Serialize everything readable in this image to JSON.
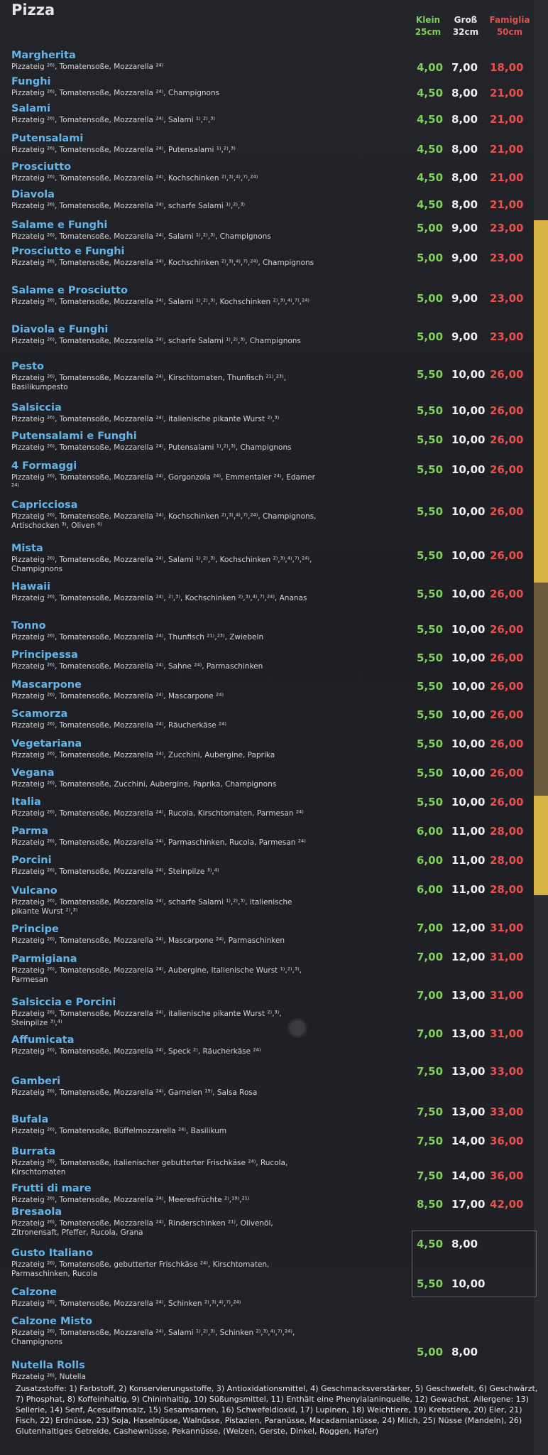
{
  "title": "Pizza",
  "headers": {
    "small": [
      "Klein",
      "25cm"
    ],
    "medium": [
      "Groß",
      "32cm"
    ],
    "large": [
      "Famiglia",
      "50cm"
    ]
  },
  "items": [
    {
      "name": "Margherita",
      "desc": "Pizzateig ²⁶⁾, Tomatensoße, Mozzarella ²⁴⁾",
      "small": "4,00",
      "medium": "7,00",
      "large": "18,00"
    },
    {
      "name": "Funghi",
      "desc": "Pizzateig ²⁶⁾, Tomatensoße, Mozzarella ²⁴⁾, Champignons",
      "small": "4,50",
      "medium": "8,00",
      "large": "21,00"
    },
    {
      "name": "Salami",
      "desc": "Pizzateig ²⁶⁾, Tomatensoße, Mozzarella ²⁴⁾, Salami ¹⁾,²⁾,³⁾",
      "small": "4,50",
      "medium": "8,00",
      "large": "21,00"
    },
    {
      "name": "Putensalami",
      "desc": "Pizzateig ²⁶⁾, Tomatensoße, Mozzarella ²⁴⁾, Putensalami ¹⁾,²⁾,³⁾",
      "small": "4,50",
      "medium": "8,00",
      "large": "21,00"
    },
    {
      "name": "Prosciutto",
      "desc": "Pizzateig ²⁶⁾, Tomatensoße, Mozzarella ²⁴⁾, Kochschinken ²⁾,³⁾,⁴⁾,⁷⁾,²⁴⁾",
      "small": "4,50",
      "medium": "8,00",
      "large": "21,00"
    },
    {
      "name": "Diavola",
      "desc": "Pizzateig ²⁶⁾, Tomatensoße, Mozzarella ²⁴⁾, scharfe Salami ¹⁾,²⁾,³⁾",
      "small": "4,50",
      "medium": "8,00",
      "large": "21,00"
    },
    {
      "name": "Salame e Funghi",
      "desc": "Pizzateig ²⁶⁾, Tomatensoße, Mozzarella ²⁴⁾, Salami ¹⁾,²⁾,³⁾, Champignons",
      "small": "5,00",
      "medium": "9,00",
      "large": "23,00"
    },
    {
      "name": "Prosciutto e Funghi",
      "desc": "Pizzateig ²⁶⁾, Tomatensoße, Mozzarella ²⁴⁾, Kochschinken ²⁾,³⁾,⁴⁾,⁷⁾,²⁴⁾, Champignons",
      "small": "5,00",
      "medium": "9,00",
      "large": "23,00"
    },
    {
      "name": "Salame e Prosciutto",
      "desc": "Pizzateig ²⁶⁾, Tomatensoße, Mozzarella ²⁴⁾, Salami ¹⁾,²⁾,³⁾, Kochschinken ²⁾,³⁾,⁴⁾,⁷⁾,²⁴⁾",
      "small": "5,00",
      "medium": "9,00",
      "large": "23,00"
    },
    {
      "name": "Diavola e Funghi",
      "desc": "Pizzateig ²⁶⁾, Tomatensoße, Mozzarella ²⁴⁾, scharfe Salami ¹⁾,²⁾,³⁾, Champignons",
      "small": "5,00",
      "medium": "9,00",
      "large": "23,00"
    },
    {
      "name": "Pesto",
      "desc": "Pizzateig ²⁶⁾, Tomatensoße, Mozzarella ²⁴⁾, Kirschtomaten, Thunfisch ²¹⁾,²³⁾, Basilikumpesto",
      "small": "5,50",
      "medium": "10,00",
      "large": "26,00"
    },
    {
      "name": "Salsiccia",
      "desc": "Pizzateig ²⁶⁾, Tomatensoße, Mozzarella ²⁴⁾, italienische pikante Wurst ²⁾,³⁾",
      "small": "5,50",
      "medium": "10,00",
      "large": "26,00"
    },
    {
      "name": "Putensalami e Funghi",
      "desc": "Pizzateig ²⁶⁾, Tomatensoße, Mozzarella ²⁴⁾, Putensalami ¹⁾,²⁾,³⁾, Champignons",
      "small": "5,50",
      "medium": "10,00",
      "large": "26,00"
    },
    {
      "name": "4 Formaggi",
      "desc": "Pizzateig ²⁶⁾, Tomatensoße, Mozzarella ²⁴⁾, Gorgonzola ²⁴⁾, Emmentaler ²⁴⁾, Edamer ²⁴⁾",
      "small": "5,50",
      "medium": "10,00",
      "large": "26,00"
    },
    {
      "name": "Capricciosa",
      "desc": "Pizzateig ²⁶⁾, Tomatensoße, Mozzarella ²⁴⁾, Kochschinken ²⁾,³⁾,⁴⁾,⁷⁾,²⁴⁾, Champignons, Artischocken ³⁾, Oliven ⁶⁾",
      "small": "5,50",
      "medium": "10,00",
      "large": "26,00"
    },
    {
      "name": "Mista",
      "desc": "Pizzateig ²⁶⁾, Tomatensoße, Mozzarella ²⁴⁾, Salami ¹⁾,²⁾,³⁾, Kochschinken ²⁾,³⁾,⁴⁾,⁷⁾,²⁴⁾, Champignons",
      "small": "5,50",
      "medium": "10,00",
      "large": "26,00"
    },
    {
      "name": "Hawaii",
      "desc": "Pizzateig ²⁶⁾, Tomatensoße, Mozzarella ²⁴⁾, ²⁾,³⁾, Kochschinken ²⁾,³⁾,⁴⁾,⁷⁾,²⁴⁾, Ananas",
      "small": "5,50",
      "medium": "10,00",
      "large": "26,00"
    },
    {
      "name": "Tonno",
      "desc": "Pizzateig ²⁶⁾, Tomatensoße, Mozzarella ²⁴⁾, Thunfisch ²¹⁾,²³⁾, Zwiebeln",
      "small": "5,50",
      "medium": "10,00",
      "large": "26,00"
    },
    {
      "name": "Principessa",
      "desc": "Pizzateig ²⁶⁾, Tomatensoße, Mozzarella ²⁴⁾, Sahne ²⁴⁾, Parmaschinken",
      "small": "5,50",
      "medium": "10,00",
      "large": "26,00"
    },
    {
      "name": "Mascarpone",
      "desc": "Pizzateig ²⁶⁾, Tomatensoße, Mozzarella ²⁴⁾, Mascarpone ²⁴⁾",
      "small": "5,50",
      "medium": "10,00",
      "large": "26,00"
    },
    {
      "name": "Scamorza",
      "desc": "Pizzateig ²⁶⁾, Tomatensoße, Mozzarella ²⁴⁾, Räucherkäse ²⁴⁾",
      "small": "5,50",
      "medium": "10,00",
      "large": "26,00"
    },
    {
      "name": "Vegetariana",
      "desc": "Pizzateig ²⁶⁾, Tomatensoße, Mozzarella ²⁴⁾, Zucchini, Aubergine, Paprika",
      "small": "5,50",
      "medium": "10,00",
      "large": "26,00"
    },
    {
      "name": "Vegana",
      "desc": "Pizzateig ²⁶⁾, Tomatensoße, Zucchini, Aubergine, Paprika, Champignons",
      "small": "5,50",
      "medium": "10,00",
      "large": "26,00"
    },
    {
      "name": "Italia",
      "desc": "Pizzateig ²⁶⁾, Tomatensoße, Mozzarella ²⁴⁾, Rucola, Kirschtomaten, Parmesan ²⁴⁾",
      "small": "5,50",
      "medium": "10,00",
      "large": "26,00"
    },
    {
      "name": "Parma",
      "desc": "Pizzateig ²⁶⁾, Tomatensoße, Mozzarella ²⁴⁾, Parmaschinken, Rucola, Parmesan ²⁴⁾",
      "small": "6,00",
      "medium": "11,00",
      "large": "28,00"
    },
    {
      "name": "Porcini",
      "desc": "Pizzateig ²⁶⁾, Tomatensoße, Mozzarella ²⁴⁾, Steinpilze ³⁾,⁴⁾",
      "small": "6,00",
      "medium": "11,00",
      "large": "28,00"
    },
    {
      "name": "Vulcano",
      "desc": "Pizzateig ²⁶⁾, Tomatensoße, Mozzarella ²⁴⁾, scharfe Salami ¹⁾,²⁾,³⁾, italienische pikante Wurst ²⁾,³⁾",
      "small": "6,00",
      "medium": "11,00",
      "large": "28,00"
    },
    {
      "name": "Principe",
      "desc": "Pizzateig ²⁶⁾, Tomatensoße, Mozzarella ²⁴⁾, Mascarpone ²⁴⁾, Parmaschinken",
      "small": "7,00",
      "medium": "12,00",
      "large": "31,00"
    },
    {
      "name": "Parmigiana",
      "desc": "Pizzateig ²⁶⁾, Tomatensoße, Mozzarella ²⁴⁾, Aubergine, Italienische Wurst ¹⁾,²⁾,³⁾, Parmesan",
      "small": "7,00",
      "medium": "12,00",
      "large": "31,00"
    },
    {
      "name": "Salsiccia e Porcini",
      "desc": "Pizzateig ²⁶⁾, Tomatensoße, Mozzarella ²⁴⁾, italienische pikante Wurst ²⁾,³⁾, Steinpilze ³⁾,⁴⁾",
      "small": "7,00",
      "medium": "13,00",
      "large": "31,00"
    },
    {
      "name": "Affumicata",
      "desc": "Pizzateig ²⁶⁾, Tomatensoße, Mozzarella ²⁴⁾, Speck ²⁾, Räucherkäse ²⁴⁾",
      "small": "7,00",
      "medium": "13,00",
      "large": "31,00"
    },
    {
      "name": "Gamberi",
      "desc": "Pizzateig ²⁶⁾, Tomatensoße, Mozzarella ²⁴⁾, Garnelen ¹⁹⁾, Salsa Rosa",
      "small": "7,50",
      "medium": "13,00",
      "large": "33,00"
    },
    {
      "name": "Bufala",
      "desc": "Pizzateig ²⁶⁾, Tomatensoße, Büffelmozzarella ²⁴⁾, Basilikum",
      "small": "7,50",
      "medium": "13,00",
      "large": "33,00"
    },
    {
      "name": "Burrata",
      "desc": "Pizzateig ²⁶⁾, Tomatensoße, italienischer gebutterter Frischkäse ²⁴⁾, Rucola, Kirschtomaten",
      "small": "7,50",
      "medium": "14,00",
      "large": "36,00"
    },
    {
      "name": "Frutti di mare",
      "desc": "Pizzateig ²⁶⁾, Tomatensoße, Mozzarella ²⁴⁾, Meeresfrüchte ²⁾,¹⁹⁾,²¹⁾",
      "small": "7,50",
      "medium": "14,00",
      "large": "36,00"
    },
    {
      "name": "Bresaola",
      "desc": "Pizzateig ²⁶⁾, Tomatensoße, Mozzarella ²⁴⁾, Rinderschinken ²¹⁾, Olivenöl, Zitronensaft, Pfeffer, Rucola, Grana",
      "small": "8,50",
      "medium": "17,00",
      "large": "42,00"
    },
    {
      "name": "Gusto Italiano",
      "desc": "Pizzateig ²⁶⁾, Tomatensoße, gebutterter Frischkäse ²⁴⁾, Kirschtomaten, Parmaschinken, Rucola",
      "small": "4,50",
      "medium": "8,00",
      "large": ""
    },
    {
      "name": "Calzone",
      "desc": "Pizzateig ²⁶⁾, Tomatensoße, Mozzarella ²⁴⁾, Schinken ²⁾,³⁾,⁴⁾,⁷⁾,²⁴⁾",
      "small": "5,50",
      "medium": "10,00",
      "large": ""
    },
    {
      "name": "Calzone Misto",
      "desc": "Pizzateig ²⁶⁾, Tomatensoße, Mozzarella ²⁴⁾, Salami ¹⁾,²⁾,³⁾, Schinken ²⁾,³⁾,⁴⁾,⁷⁾,²⁴⁾, Champignons",
      "small": "",
      "medium": "",
      "large": ""
    },
    {
      "name": "Nutella Rolls",
      "desc": "Pizzateig ²⁶⁾, Nutella",
      "small": "5,00",
      "medium": "8,00",
      "large": ""
    }
  ],
  "footnote": "Zusatzstoffe: 1) Farbstoff, 2) Konservierungsstoffe, 3) Antioxidationsmittel, 4) Geschmacksverstärker, 5) Geschwefelt, 6) Geschwärzt, 7) Phosphat, 8) Koffeinhaltig, 9) Chininhaltig, 10) Süßungsmittel, 11) Enthält eine Phenylalaninquelle, 12) Gewachst. Allergene: 13) Sellerie, 14) Senf, Acesulfamsalz, 15) Sesamsamen, 16) Schwefeldioxid, 17) Lupinen, 18) Weichtiere, 19) Krebstiere, 20) Eier, 21) Fisch, 22) Erdnüsse, 23) Soja, Haselnüsse, Walnüsse, Pistazien, Paranüsse, Macadamianüsse, 24) Milch, 25) Nüsse (Mandeln), 26) Glutenhaltiges Getreide, Cashewnüsse, Pekannüsse, (Weizen, Gerste, Dinkel, Roggen, Hafer)"
}
